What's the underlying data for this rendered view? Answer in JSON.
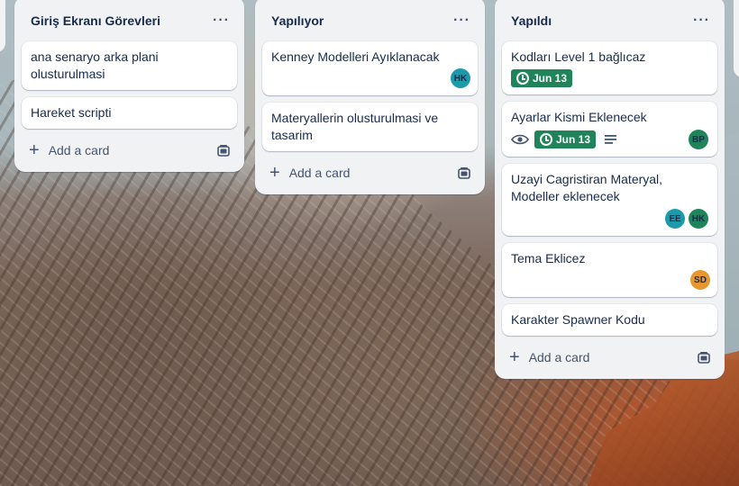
{
  "lists": [
    {
      "title": "Giriş Ekranı Görevleri",
      "menu": "···",
      "cards": [
        {
          "title": "ana senaryo arka plani olusturulmasi"
        },
        {
          "title": "Hareket scripti"
        }
      ],
      "add_label": "Add a card"
    },
    {
      "title": "Yapılıyor",
      "menu": "···",
      "cards": [
        {
          "title": "Kenney Modelleri Ayıklanacak",
          "members": [
            "HK"
          ]
        },
        {
          "title": "Materyallerin olusturulmasi ve tasarim"
        }
      ],
      "add_label": "Add a card"
    },
    {
      "title": "Yapıldı",
      "menu": "···",
      "cards": [
        {
          "title": "Kodları Level 1 bağlıcaz",
          "due": "Jun 13"
        },
        {
          "title": "Ayarlar Kismi Eklenecek",
          "due": "Jun 13",
          "watching": true,
          "has_description": true,
          "members": [
            "BP"
          ]
        },
        {
          "title": "Uzayi Cagristiran Materyal, Modeller eklenecek",
          "members": [
            "EE",
            "HK"
          ]
        },
        {
          "title": "Tema Eklicez",
          "members": [
            "SD"
          ]
        },
        {
          "title": "Karakter Spawner Kodu"
        }
      ],
      "add_label": "Add a card"
    }
  ],
  "member_colors": {
    "HK": "#1d9aaa",
    "BP": "#1f845a",
    "EE": "#1d9aaa",
    "SD": "#e8962e"
  },
  "due_color": "#1f845a",
  "icons": {
    "add": "+",
    "watch": "eye-icon",
    "description": "description-icon",
    "template": "card-template-icon",
    "due": "clock-icon"
  }
}
